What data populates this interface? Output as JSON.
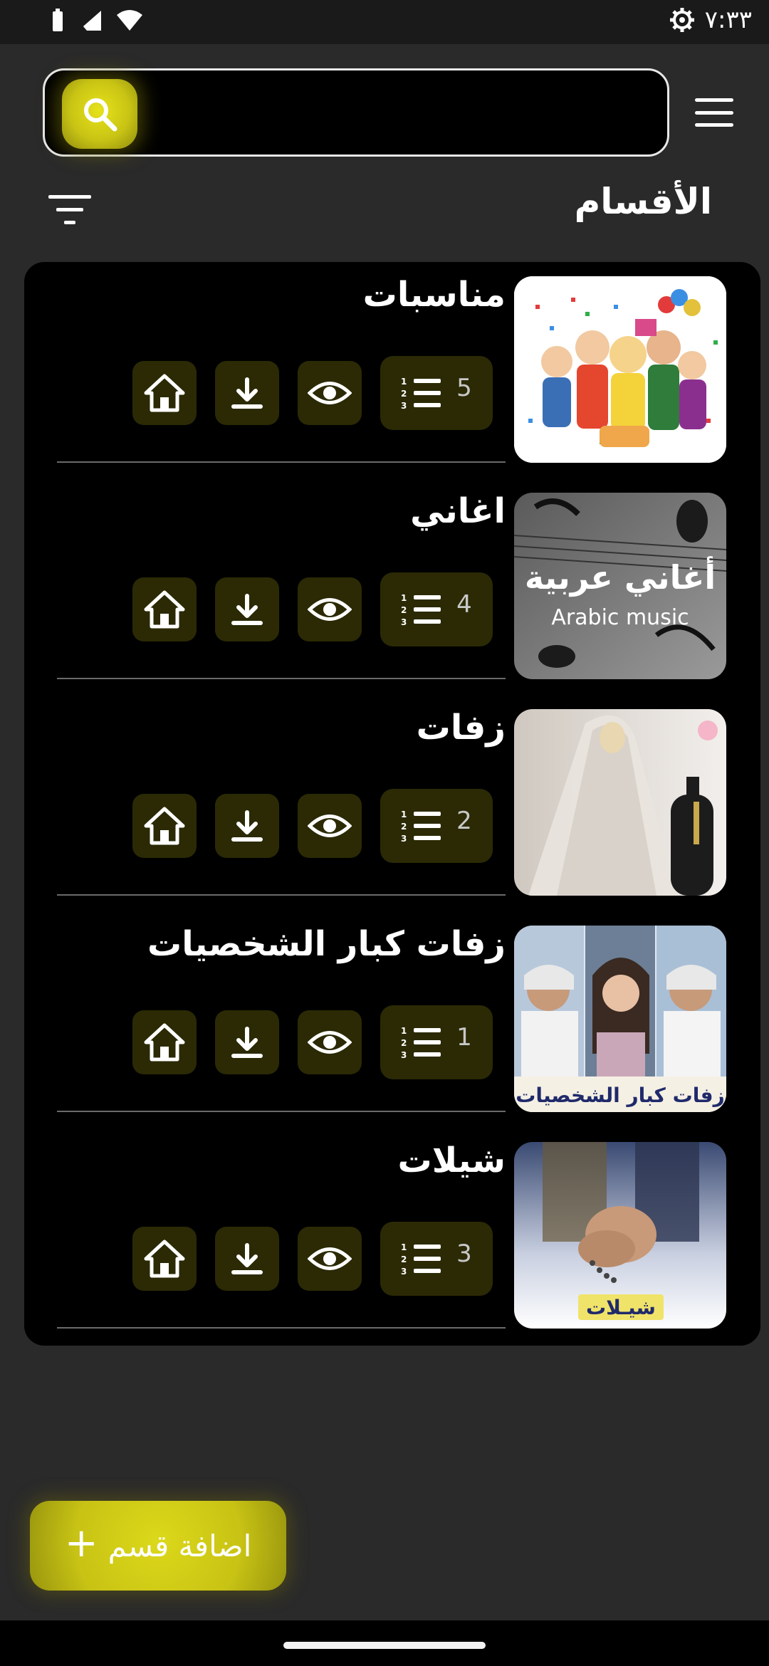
{
  "status_bar": {
    "time": "٧:٣٣"
  },
  "header": {
    "search_icon": "search-icon",
    "menu_icon": "menu-icon"
  },
  "section": {
    "title": "الأقسام",
    "filter_icon": "filter-icon"
  },
  "categories": [
    {
      "title": "مناسبات",
      "count": "5",
      "image": "party-celebration-illustration"
    },
    {
      "title": "اغاني",
      "count": "4",
      "image": "arabic-music-headphones",
      "image_text_ar": "أغاني عربية",
      "image_text_en": "Arabic music"
    },
    {
      "title": "زفات",
      "count": "2",
      "image": "bride-veil-photo"
    },
    {
      "title": "زفات كبار الشخصيات",
      "count": "1",
      "image": "singers-collage",
      "image_text_ar": "زفات كبار الشخصيات"
    },
    {
      "title": "شيلات",
      "count": "3",
      "image": "hands-prayer-beads",
      "image_text_ar": "شيـلات"
    }
  ],
  "row_action_icons": [
    "numbered-list-icon",
    "eye-icon",
    "download-icon",
    "home-icon"
  ],
  "fab": {
    "label": "اضافة قسم",
    "plus": "+"
  },
  "colors": {
    "accent": "#c9c414",
    "button_bg": "#2b2a05",
    "panel_bg": "#000000",
    "page_bg": "#2a2a2a"
  }
}
